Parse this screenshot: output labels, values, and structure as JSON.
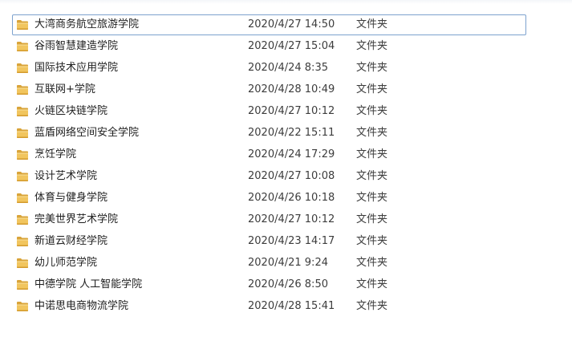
{
  "file_list": {
    "rows": [
      {
        "name": "大湾商务航空旅游学院",
        "modified": "2020/4/27 14:50",
        "type": "文件夹",
        "focused": true
      },
      {
        "name": "谷雨智慧建造学院",
        "modified": "2020/4/27 15:04",
        "type": "文件夹"
      },
      {
        "name": "国际技术应用学院",
        "modified": "2020/4/24 8:35",
        "type": "文件夹"
      },
      {
        "name": "互联网+学院",
        "modified": "2020/4/28 10:49",
        "type": "文件夹"
      },
      {
        "name": "火链区块链学院",
        "modified": "2020/4/27 10:12",
        "type": "文件夹"
      },
      {
        "name": "蓝盾网络空间安全学院",
        "modified": "2020/4/22 15:11",
        "type": "文件夹"
      },
      {
        "name": "烹饪学院",
        "modified": "2020/4/24 17:29",
        "type": "文件夹"
      },
      {
        "name": "设计艺术学院",
        "modified": "2020/4/27 10:08",
        "type": "文件夹"
      },
      {
        "name": "体育与健身学院",
        "modified": "2020/4/26 10:18",
        "type": "文件夹"
      },
      {
        "name": "完美世界艺术学院",
        "modified": "2020/4/27 10:12",
        "type": "文件夹"
      },
      {
        "name": "新道云财经学院",
        "modified": "2020/4/23 14:17",
        "type": "文件夹"
      },
      {
        "name": "幼儿师范学院",
        "modified": "2020/4/21 9:24",
        "type": "文件夹"
      },
      {
        "name": "中德学院 人工智能学院",
        "modified": "2020/4/26 8:50",
        "type": "文件夹"
      },
      {
        "name": "中诺思电商物流学院",
        "modified": "2020/4/28 15:41",
        "type": "文件夹"
      }
    ],
    "icon": "folder-icon",
    "colors": {
      "folder_body": "#e8b64a",
      "folder_tab": "#d9a43a",
      "focus_border": "#7da2ce"
    }
  }
}
